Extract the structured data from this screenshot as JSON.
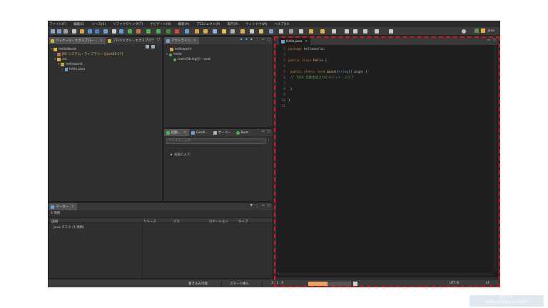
{
  "menu": [
    "ファイル(F)",
    "編集(E)",
    "ソース(S)",
    "リファクタリング(T)",
    "ナビゲート(N)",
    "検索(A)",
    "プロジェクト(P)",
    "実行(R)",
    "ウィンドウ(W)",
    "ヘルプ(H)"
  ],
  "perspective": "Java",
  "package_explorer": {
    "tabs": [
      "パッケージ・エクスプロー...",
      "プロジェクト・エクスプロ..."
    ],
    "tree": [
      "HelloWorld",
      "JRE システム・ライブラリー [JavaSE-17]",
      "src",
      "helloworld",
      "Hello.java"
    ]
  },
  "outline": {
    "tab": "アウトライン",
    "tree": [
      "helloworld",
      "Hello",
      "main(String[]) : void"
    ]
  },
  "tasks_panel": {
    "tabs": [
      "起動...",
      "Gradl...",
      "サーバー",
      "Boot..."
    ],
    "placeholder": "フィルター入力",
    "item": "お気に入り"
  },
  "markers": {
    "tab": "マーカー",
    "count": "0 項目",
    "columns": [
      "説明",
      "リソース",
      "パス",
      "ロケーション",
      "タイプ"
    ],
    "row": "Java タスク (1 項目)"
  },
  "editor": {
    "tab": "Hello.java",
    "lines": [
      {
        "n": "1",
        "parts": [
          {
            "t": "package ",
            "c": "kw"
          },
          {
            "t": "helloworld;",
            "c": ""
          }
        ]
      },
      {
        "n": "2",
        "parts": []
      },
      {
        "n": "3",
        "parts": [
          {
            "t": "public class ",
            "c": "kw"
          },
          {
            "t": "Hello",
            "c": "cls"
          },
          {
            "t": " {",
            "c": ""
          }
        ]
      },
      {
        "n": "4",
        "parts": []
      },
      {
        "n": "5",
        "parts": [
          {
            "t": "    public static void ",
            "c": "kw"
          },
          {
            "t": "main",
            "c": "cls"
          },
          {
            "t": "(",
            "c": ""
          },
          {
            "t": "String",
            "c": "ty"
          },
          {
            "t": "[] args) {",
            "c": ""
          }
        ]
      },
      {
        "n": "6",
        "parts": [
          {
            "t": "        // TODO 自動生成されたメソッド・スタブ",
            "c": "cm"
          }
        ]
      },
      {
        "n": "7",
        "parts": []
      },
      {
        "n": "8",
        "parts": [
          {
            "t": "    }",
            "c": ""
          }
        ]
      },
      {
        "n": "9",
        "parts": []
      },
      {
        "n": "10",
        "parts": [
          {
            "t": "}",
            "c": ""
          }
        ]
      },
      {
        "n": "11",
        "parts": []
      }
    ]
  },
  "status": {
    "writable": "書き込み可能",
    "insert": "スマート挿入",
    "position": "1 : 1 : 0",
    "progress": 0.45,
    "encoding": "UTF-8",
    "line_ending": "LF"
  },
  "watermark": [
    "ITビーナ",
    "「知識の1歩を超えるITの探求」"
  ],
  "colors": {
    "highlight": "#d0171f",
    "keyword": "#cc7832",
    "comment": "#629755"
  }
}
